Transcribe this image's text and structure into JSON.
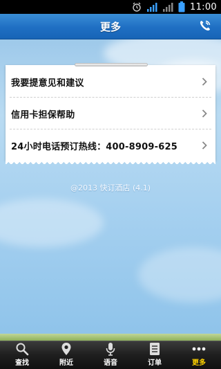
{
  "status_bar": {
    "time": "11:00",
    "icons": [
      "alarm-icon",
      "signal-icon",
      "signal-icon",
      "battery-icon"
    ]
  },
  "header": {
    "title": "更多",
    "right_icon": "phone-icon"
  },
  "menu": {
    "items": [
      {
        "label": "我要提意见和建议",
        "icon": "chevron-right-icon"
      },
      {
        "label": "信用卡担保帮助",
        "icon": "chevron-right-icon"
      },
      {
        "label": "24小时电话预订热线：400-8909-625",
        "icon": "chevron-right-icon"
      }
    ]
  },
  "footer_text": "@2013 快订酒店 (4.1)",
  "tabs": [
    {
      "label": "查找",
      "icon": "search-icon"
    },
    {
      "label": "附近",
      "icon": "location-pin-icon"
    },
    {
      "label": "语音",
      "icon": "microphone-icon"
    },
    {
      "label": "订单",
      "icon": "order-list-icon"
    },
    {
      "label": "更多",
      "icon": "more-dots-icon",
      "active": true
    }
  ],
  "colors": {
    "header_blue": "#1f6fc3",
    "tab_active": "#ffd200",
    "tab_bar": "#1e1e1e"
  }
}
